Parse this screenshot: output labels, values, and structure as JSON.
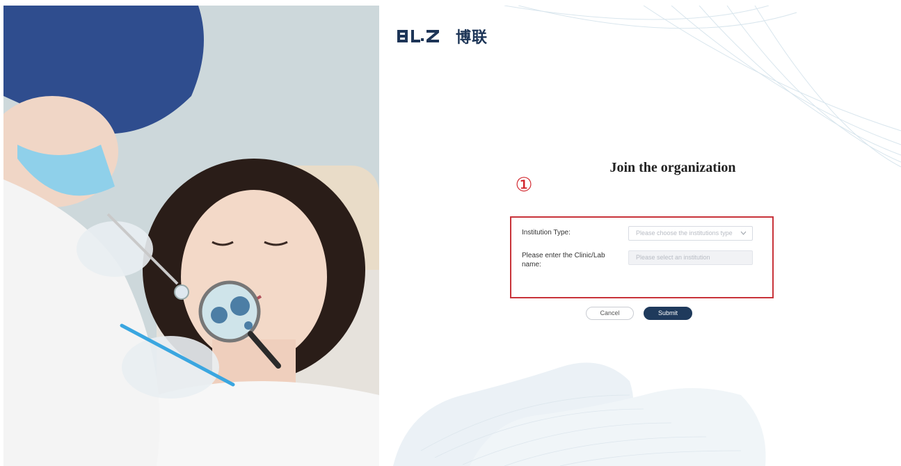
{
  "brand": {
    "logo_latin": "BLZ",
    "logo_chinese": "博联",
    "accent_color": "#1f3a5c",
    "highlight_color": "#c8333a"
  },
  "page": {
    "title": "Join the organization",
    "step_marker": "①"
  },
  "form": {
    "institution_type_label": "Institution Type:",
    "institution_type_placeholder": "Please choose the institutions type",
    "clinic_name_label": "Please enter the Clinic/Lab name:",
    "clinic_name_placeholder": "Please select an institution"
  },
  "actions": {
    "cancel_label": "Cancel",
    "submit_label": "Submit"
  },
  "images": {
    "hero": "dentist-examining-patient-photo"
  }
}
